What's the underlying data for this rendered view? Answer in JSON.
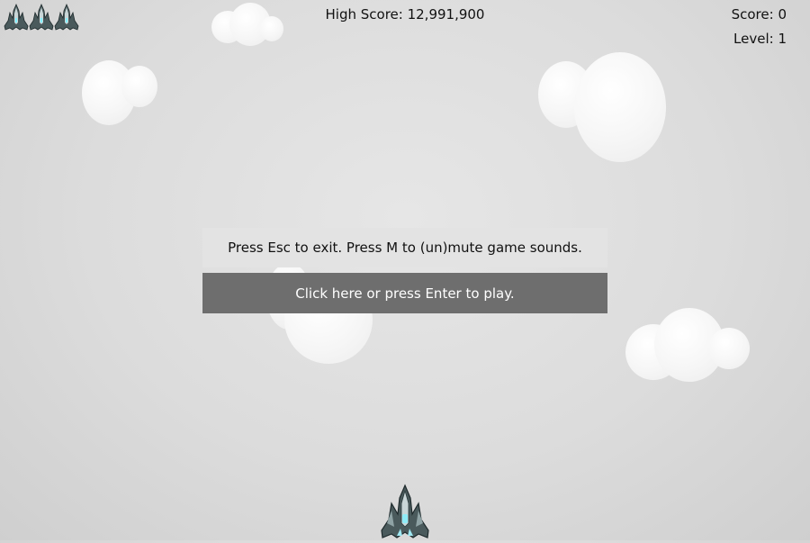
{
  "hud": {
    "high_score": "High Score: 12,991,900",
    "score": "Score: 0",
    "level": "Level: 1",
    "lives": 3
  },
  "menu": {
    "instructions": "Press Esc to exit. Press M to (un)mute game sounds.",
    "play_label": "Click here or press Enter to play."
  },
  "colors": {
    "background": "#dcdcdc",
    "banner": "#e3e3e3",
    "play_button": "#6e6e6e"
  }
}
